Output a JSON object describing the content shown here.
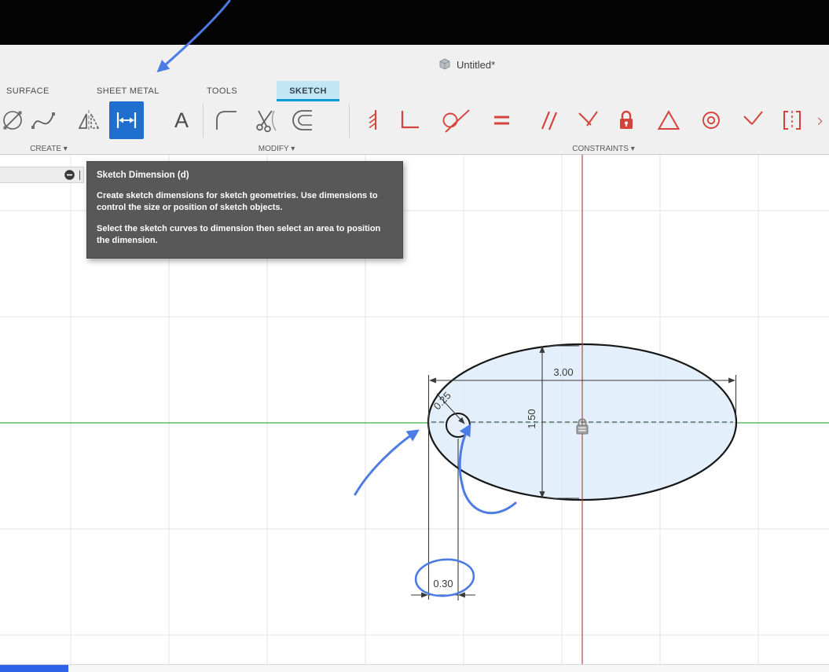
{
  "titlebar": {
    "document_title": "Untitled*"
  },
  "ribbon": {
    "tabs": [
      {
        "label": "SURFACE"
      },
      {
        "label": "SHEET METAL"
      },
      {
        "label": "TOOLS"
      },
      {
        "label": "SKETCH",
        "active": true
      }
    ],
    "groups": [
      {
        "label": "CREATE ▾"
      },
      {
        "label": "MODIFY ▾"
      },
      {
        "label": "CONSTRAINTS ▾"
      }
    ],
    "text_tool_glyph": "A",
    "create_icons": [
      "two-point-circle",
      "fit-point-spline",
      "mirror",
      "sketch-dimension",
      "sketch-text"
    ],
    "modify_icons": [
      "fillet",
      "trim",
      "offset"
    ],
    "constraint_icons": [
      "fix-hatch",
      "horizontal-vertical",
      "tangent",
      "equal",
      "parallel",
      "perpendicular",
      "lock",
      "triangle",
      "concentric",
      "midpoint",
      "symmetry",
      "curvature"
    ]
  },
  "tooltip": {
    "title": "Sketch Dimension (d)",
    "paragraph1": "Create sketch dimensions for sketch geometries. Use dimensions to control the size or position of sketch objects.",
    "paragraph2": "Select the sketch curves to dimension then select an area to position the dimension."
  },
  "sketch": {
    "dim_width": "3.00",
    "dim_height": "1.50",
    "dim_offset": "0.30",
    "dim_diameter": "0.25"
  },
  "colors": {
    "active_tool_blue": "#1e6fd0",
    "tab_highlight": "#c3e6f7",
    "tab_underline": "#0a9bd7",
    "constraint_red": "#d5443c",
    "axis_green": "#3fae49",
    "axis_red": "#b04a42",
    "annotation_blue": "#4c7ce3",
    "tooltip_bg": "#585858",
    "ellipse_fill": "#e9f1fa"
  }
}
